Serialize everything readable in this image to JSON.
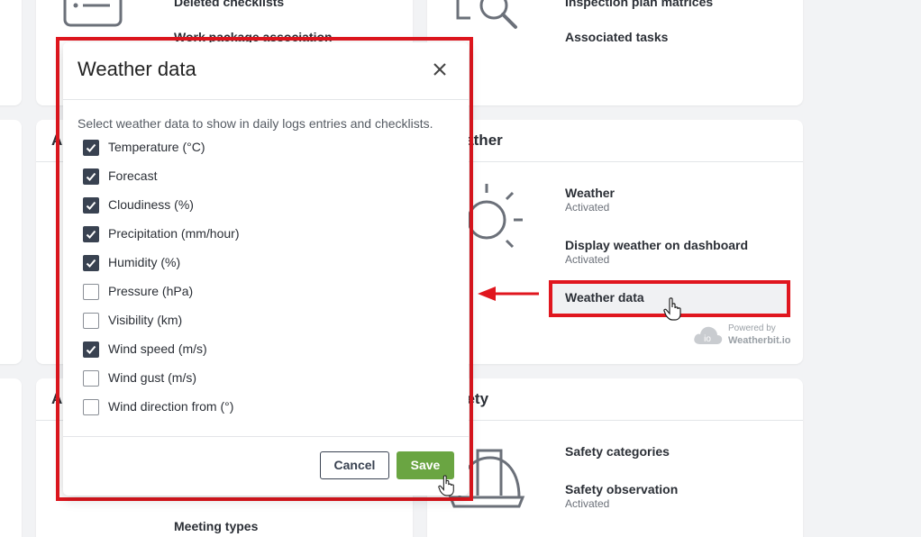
{
  "background": {
    "top_left_card": {
      "links": [
        "Deleted checklists",
        "Work package association"
      ]
    },
    "top_right_card": {
      "links": [
        "Inspection plan matrices",
        "Associated tasks"
      ]
    },
    "weather_card": {
      "title": "Weather",
      "items": [
        {
          "label": "Weather",
          "status": "Activated"
        },
        {
          "label": "Display weather on dashboard",
          "status": "Activated"
        },
        {
          "label": "Weather data"
        }
      ],
      "powered_by": {
        "line1": "Powered by",
        "line2": "Weatherbit.io",
        "logo_text": "io"
      }
    },
    "safety_card": {
      "title": "Safety",
      "items": [
        {
          "label": "Safety categories"
        },
        {
          "label": "Safety observation",
          "status": "Activated"
        }
      ]
    },
    "bottom_left_card": {
      "title": "A",
      "links": [
        "Meeting types"
      ]
    },
    "mid_left_card": {
      "title": "A"
    }
  },
  "modal": {
    "title": "Weather data",
    "description": "Select weather data to show in daily logs entries and checklists.",
    "options": [
      {
        "label": "Temperature (°C)",
        "checked": true
      },
      {
        "label": "Forecast",
        "checked": true
      },
      {
        "label": "Cloudiness (%)",
        "checked": true
      },
      {
        "label": "Precipitation (mm/hour)",
        "checked": true
      },
      {
        "label": "Humidity (%)",
        "checked": true
      },
      {
        "label": "Pressure (hPa)",
        "checked": false
      },
      {
        "label": "Visibility (km)",
        "checked": false
      },
      {
        "label": "Wind speed (m/s)",
        "checked": true
      },
      {
        "label": "Wind gust (m/s)",
        "checked": false
      },
      {
        "label": "Wind direction from (°)",
        "checked": false
      }
    ],
    "cancel_label": "Cancel",
    "save_label": "Save"
  },
  "colors": {
    "annotation_red": "#e0161e",
    "checkbox_checked": "#394251",
    "save_green": "#6aa542"
  },
  "icons": [
    "checklist-icon",
    "magnifier-icon",
    "sun-icon",
    "hardhat-icon",
    "close-icon",
    "check-icon",
    "arrow-icon",
    "hand-cursor-icon"
  ]
}
